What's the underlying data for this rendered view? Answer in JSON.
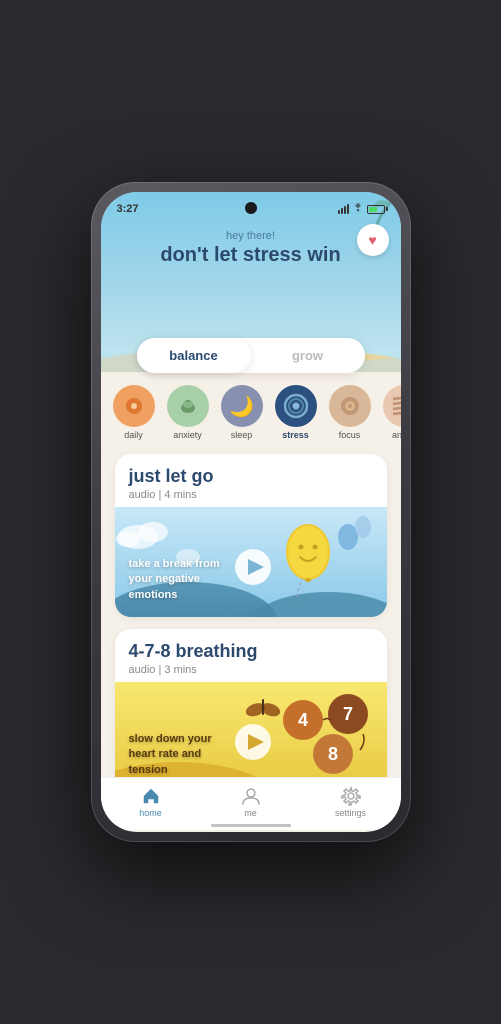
{
  "status": {
    "time": "3:27"
  },
  "header": {
    "greeting": "hey there!",
    "title": "don't let stress win"
  },
  "tabs": [
    {
      "id": "balance",
      "label": "balance",
      "active": true
    },
    {
      "id": "grow",
      "label": "grow",
      "active": false
    }
  ],
  "categories": [
    {
      "id": "daily",
      "label": "daily",
      "active": false,
      "color": "#f0a060",
      "emoji": "🌀"
    },
    {
      "id": "anxiety",
      "label": "anxiety",
      "active": false,
      "color": "#a8d0b0",
      "emoji": "🥣"
    },
    {
      "id": "sleep",
      "label": "sleep",
      "active": false,
      "color": "#8090b8",
      "emoji": "🌙"
    },
    {
      "id": "stress",
      "label": "stress",
      "active": true,
      "color": "#5080a8",
      "emoji": "🌐"
    },
    {
      "id": "focus",
      "label": "focus",
      "active": false,
      "color": "#d0a890",
      "emoji": "🎯"
    },
    {
      "id": "anger",
      "label": "anger",
      "active": false,
      "color": "#e8b898",
      "emoji": "〰️"
    }
  ],
  "cards": [
    {
      "id": "just-let-go",
      "title": "just let go",
      "type": "audio",
      "duration": "4 mins",
      "description": "take a break from\nyour negative\nemotions",
      "theme": "blue"
    },
    {
      "id": "breathing",
      "title": "4-7-8 breathing",
      "type": "audio",
      "duration": "3 mins",
      "description": "slow down your\nheart rate and\ntension",
      "theme": "yellow"
    }
  ],
  "nav": {
    "items": [
      {
        "id": "home",
        "label": "home",
        "icon": "🏠",
        "active": true
      },
      {
        "id": "me",
        "label": "me",
        "icon": "👤",
        "active": false
      },
      {
        "id": "settings",
        "label": "settings",
        "icon": "⚙️",
        "active": false
      }
    ]
  },
  "colors": {
    "accent": "#4a8ab0",
    "bg": "#f5f0e8",
    "header_bg": "#7ecbe8"
  }
}
